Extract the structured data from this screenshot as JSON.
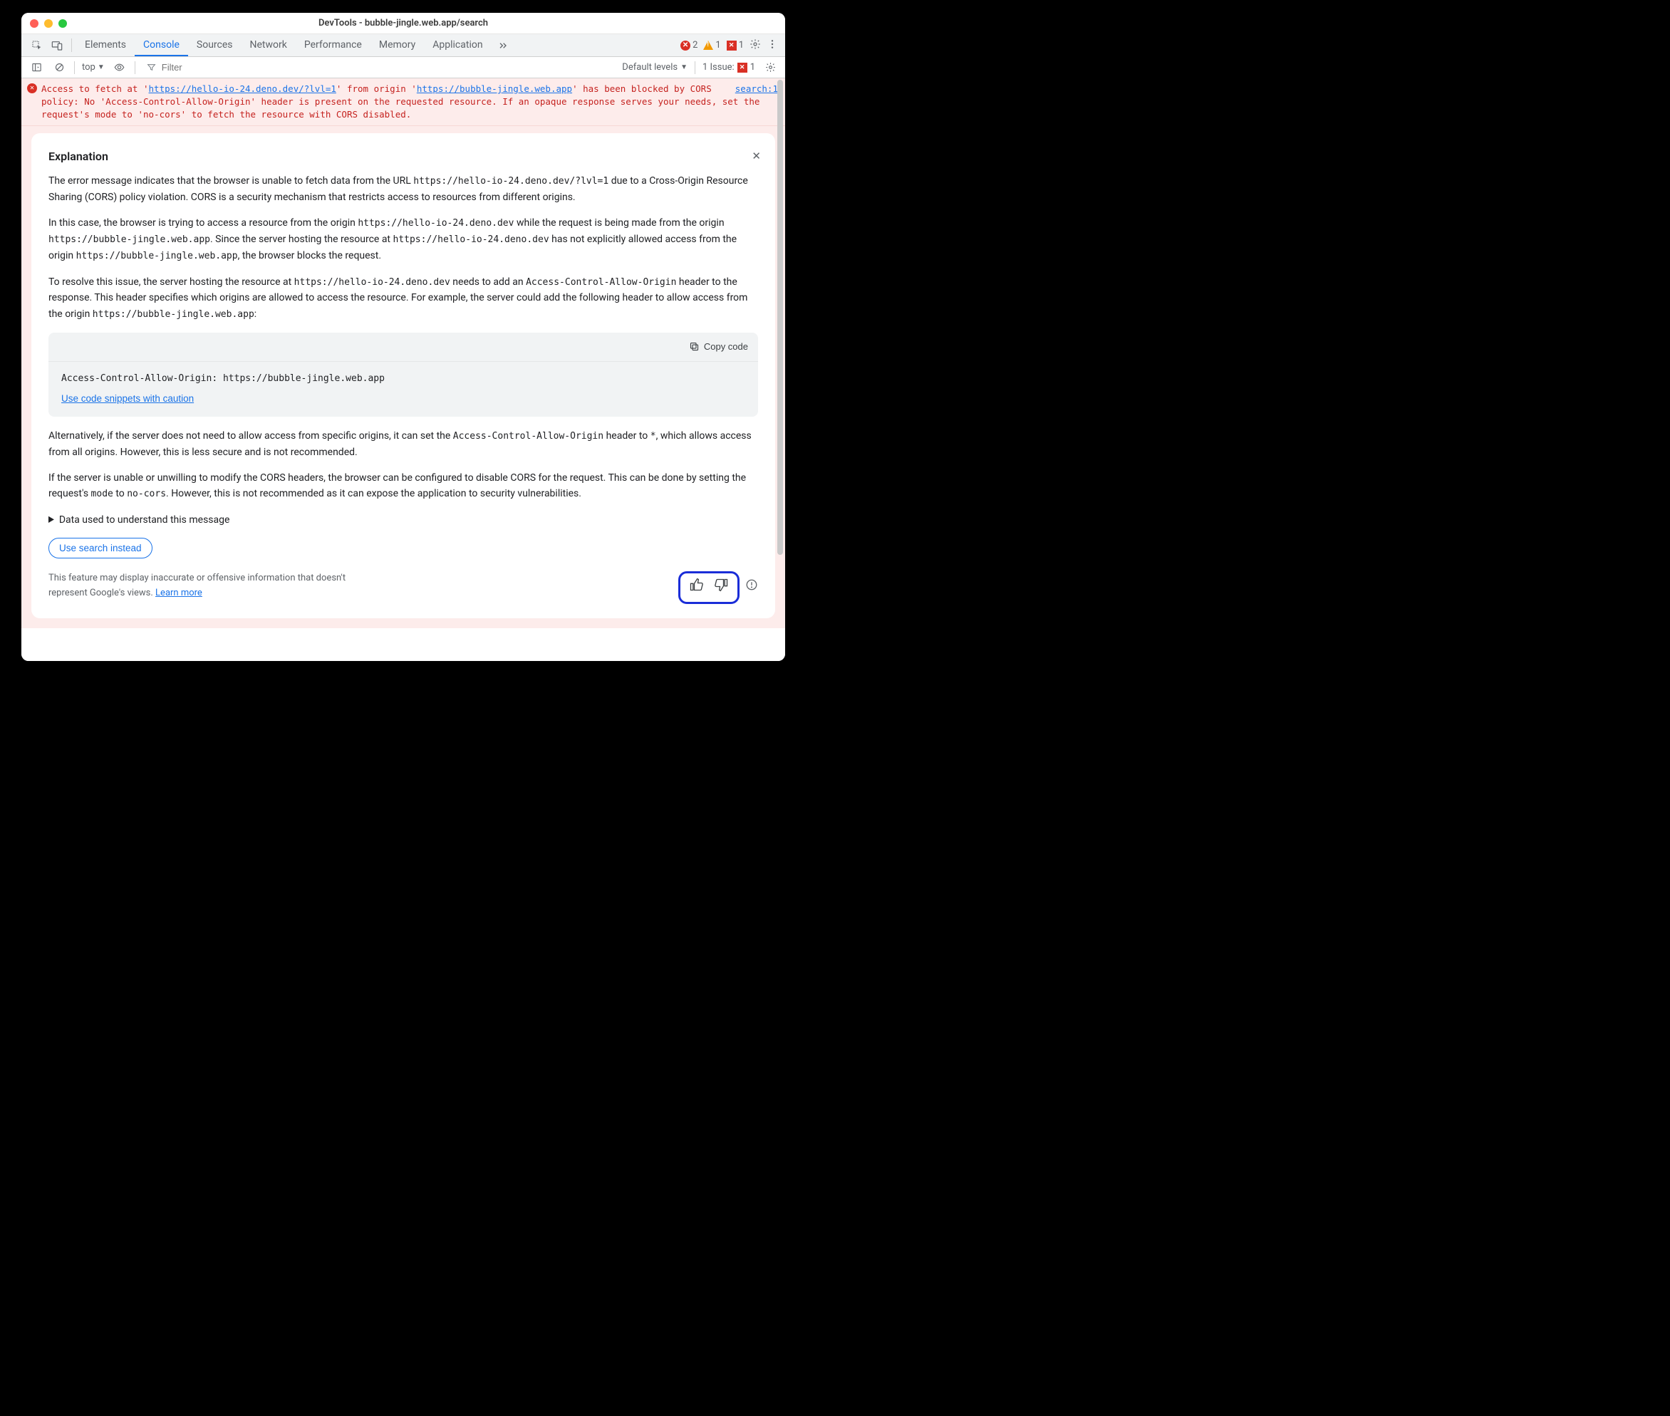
{
  "window_title": "DevTools - bubble-jingle.web.app/search",
  "tabs": [
    "Elements",
    "Console",
    "Sources",
    "Network",
    "Performance",
    "Memory",
    "Application"
  ],
  "active_tab": "Console",
  "counts": {
    "errors": "2",
    "warnings": "1",
    "issues_badge": "1"
  },
  "filter": {
    "context": "top",
    "placeholder": "Filter",
    "levels": "Default levels",
    "issues_label": "1 Issue:",
    "issues_count": "1"
  },
  "error": {
    "pre1": "Access to fetch at '",
    "url1": "https://hello-io-24.deno.dev/?lvl=1",
    "mid1": "' from origin '",
    "url2": "https://bubble-jingle.web.app",
    "post1": "' has been blocked by CORS policy: No 'Access-Control-Allow-Origin' header is present on the requested resource. If an opaque response serves your needs, set the request's mode to 'no-cors' to fetch the resource with CORS disabled.",
    "source": "search:1"
  },
  "explain": {
    "title": "Explanation",
    "p1a": "The error message indicates that the browser is unable to fetch data from the URL ",
    "p1_code": "https://hello-io-24.deno.dev/?lvl=1",
    "p1b": " due to a Cross-Origin Resource Sharing (CORS) policy violation. CORS is a security mechanism that restricts access to resources from different origins.",
    "p2a": "In this case, the browser is trying to access a resource from the origin ",
    "p2_c1": "https://hello-io-24.deno.dev",
    "p2b": " while the request is being made from the origin ",
    "p2_c2": "https://bubble-jingle.web.app",
    "p2c": ". Since the server hosting the resource at ",
    "p2_c3": "https://hello-io-24.deno.dev",
    "p2d": " has not explicitly allowed access from the origin ",
    "p2_c4": "https://bubble-jingle.web.app",
    "p2e": ", the browser blocks the request.",
    "p3a": "To resolve this issue, the server hosting the resource at ",
    "p3_c1": "https://hello-io-24.deno.dev",
    "p3b": " needs to add an ",
    "p3_c2": "Access-Control-Allow-Origin",
    "p3c": " header to the response. This header specifies which origins are allowed to access the resource. For example, the server could add the following header to allow access from the origin ",
    "p3_c3": "https://bubble-jingle.web.app",
    "p3d": ":",
    "copy": "Copy code",
    "code": "Access-Control-Allow-Origin: https://bubble-jingle.web.app",
    "caution": "Use code snippets with caution",
    "p4a": "Alternatively, if the server does not need to allow access from specific origins, it can set the ",
    "p4_c1": "Access-Control-Allow-Origin",
    "p4b": " header to ",
    "p4_c2": "*",
    "p4c": ", which allows access from all origins. However, this is less secure and is not recommended.",
    "p5a": "If the server is unable or unwilling to modify the CORS headers, the browser can be configured to disable CORS for the request. This can be done by setting the request's ",
    "p5_c1": "mode",
    "p5b": " to ",
    "p5_c2": "no-cors",
    "p5c": ". However, this is not recommended as it can expose the application to security vulnerabilities.",
    "details": "Data used to understand this message",
    "search_btn": "Use search instead",
    "disclaimer": "This feature may display inaccurate or offensive information that doesn't represent Google's views. ",
    "learn": "Learn more"
  }
}
